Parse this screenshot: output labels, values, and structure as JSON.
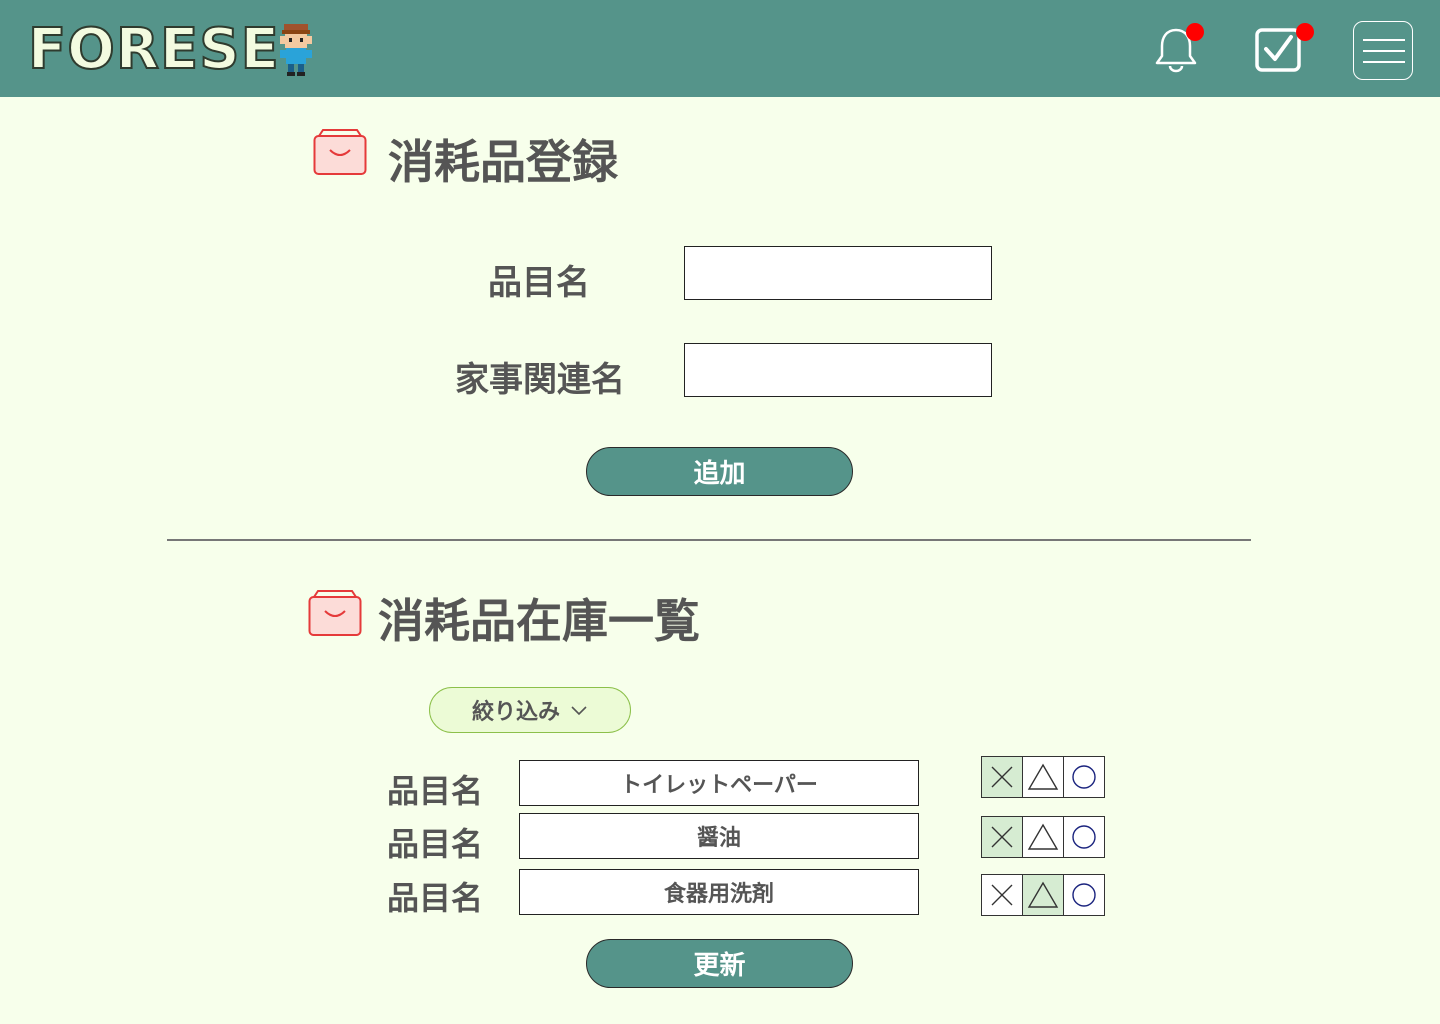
{
  "header": {
    "logo_text": "FORESE",
    "icons": [
      "bell-icon",
      "task-check-icon",
      "hamburger-menu-icon"
    ],
    "badge_color": "#ff0000",
    "background": "#55948a"
  },
  "register": {
    "title": "消耗品登録",
    "item_label": "品目名",
    "item_value": "",
    "chore_label": "家事関連名",
    "chore_value": "",
    "add_button": "追加"
  },
  "inventory": {
    "title": "消耗品在庫一覧",
    "filter_label": "絞り込み",
    "rows": [
      {
        "label": "品目名",
        "name": "トイレットペーパー",
        "status": "x"
      },
      {
        "label": "品目名",
        "name": "醤油",
        "status": "x"
      },
      {
        "label": "品目名",
        "name": "食器用洗剤",
        "status": "triangle"
      }
    ],
    "status_options": [
      "×",
      "△",
      "○"
    ],
    "update_button": "更新"
  },
  "colors": {
    "accent": "#55948a",
    "page_bg": "#f7ffeb",
    "selected_cell": "#d6ecd2",
    "cart_icon": "#e53a3a"
  }
}
